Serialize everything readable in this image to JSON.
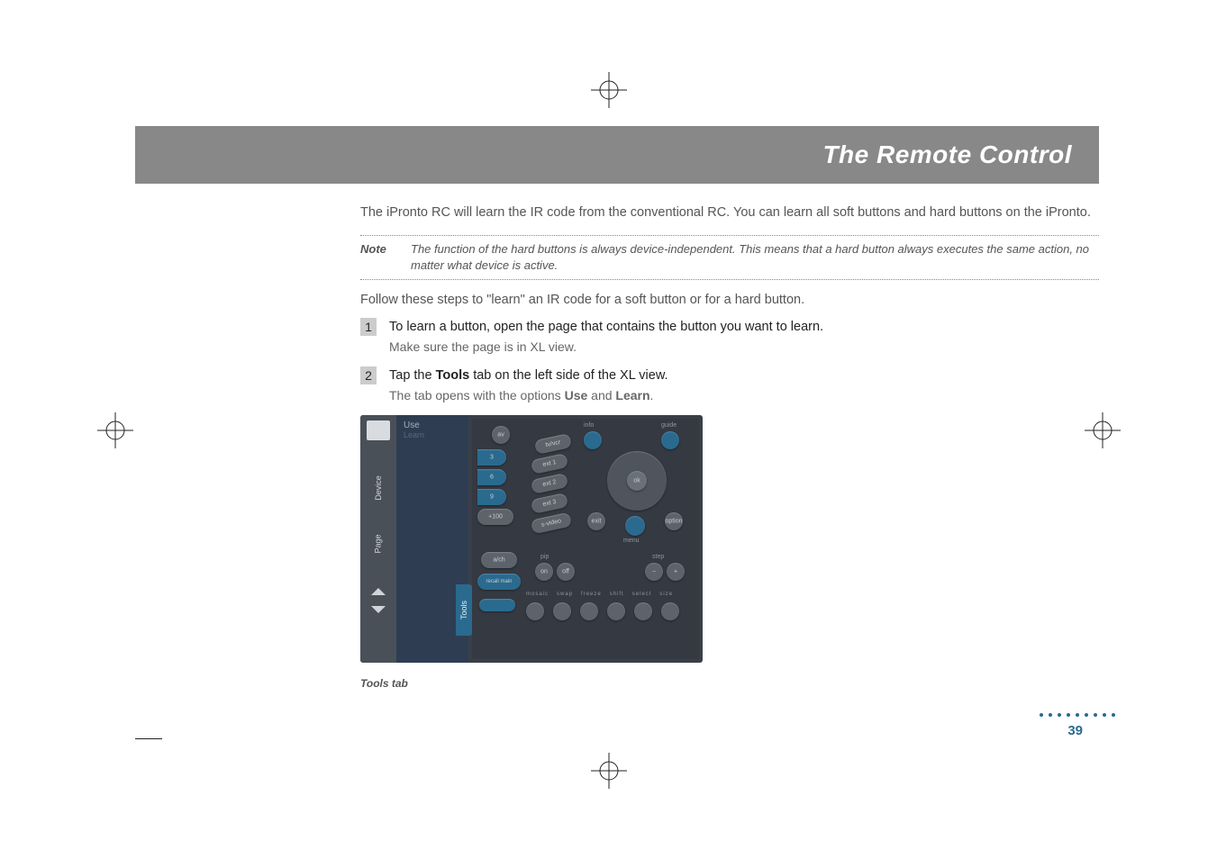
{
  "header": {
    "title": "The Remote Control"
  },
  "intro": "The iPronto RC will learn the IR code from the conventional RC. You can learn all soft buttons and hard buttons on the iPronto.",
  "note": {
    "label": "Note",
    "text": "The function of the hard buttons is always device-independent. This means that a hard button always executes the same action, no matter what device is active."
  },
  "follow": "Follow these steps to \"learn\" an IR code for a soft button or for a hard button.",
  "steps": [
    {
      "num": "1",
      "title": "To learn a button, open the page that contains the button you want to learn.",
      "sub": "Make sure the page is in XL view."
    },
    {
      "num": "2",
      "title_pre": "Tap the ",
      "title_bold1": "Tools",
      "title_mid": " tab on the left side of the XL view.",
      "sub_pre": "The tab opens with the options ",
      "sub_bold1": "Use",
      "sub_mid": " and ",
      "sub_bold2": "Learn",
      "sub_post": "."
    }
  ],
  "screenshot": {
    "side_tabs": {
      "device": "Device",
      "page": "Page",
      "tools": "Tools"
    },
    "panel": {
      "use": "Use",
      "learn": "Learn"
    },
    "remote": {
      "top_small": [
        "info",
        "guide"
      ],
      "av": "av",
      "nums": [
        "3",
        "6",
        "9",
        "+100"
      ],
      "oblongs": [
        "tv/vcr",
        "ext 1",
        "ext 2",
        "ext 3",
        "s-video"
      ],
      "ok": "ok",
      "exit": "exit",
      "menu": "menu",
      "a_ch": "a/ch",
      "recall": "recall main",
      "pip": "pip",
      "on_off": [
        "on",
        "off"
      ],
      "step": "step",
      "minus_plus": [
        "−",
        "+"
      ],
      "bottom_labels": [
        "mosaic",
        "swap",
        "freeze",
        "shift",
        "select",
        "size"
      ],
      "option": "option"
    }
  },
  "caption": "Tools tab",
  "page_number": "39"
}
